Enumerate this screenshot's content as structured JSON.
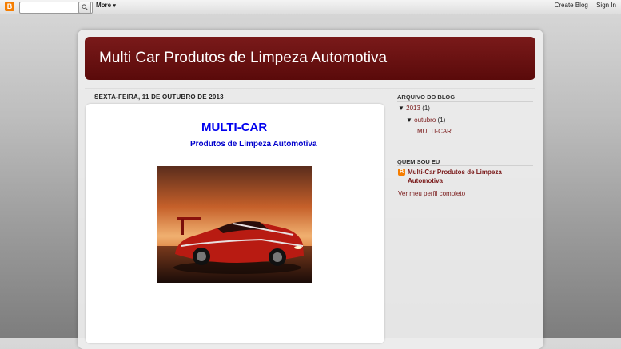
{
  "navbar": {
    "logo": "B",
    "search_value": "",
    "more_label": "More",
    "create_blog": "Create Blog",
    "sign_in": "Sign In"
  },
  "header": {
    "title": "Multi Car Produtos de Limpeza Automotiva"
  },
  "post": {
    "date": "SEXTA-FEIRA, 11 DE OUTUBRO DE 2013",
    "title": "MULTI-CAR",
    "subtitle": "Produtos de Limpeza Automotiva"
  },
  "sidebar": {
    "archive_heading": "ARQUIVO DO BLOG",
    "year": "2013",
    "year_count": "(1)",
    "month": "outubro",
    "month_count": "(1)",
    "post_link": "MULTI-CAR",
    "post_ellipsis": "...",
    "about_heading": "QUEM SOU EU",
    "profile_name_line1": "Multi-Car Produtos de Limpeza",
    "profile_name_line2": "Automotiva",
    "profile_link": "Ver meu perfil completo"
  },
  "icons": {
    "blogger": "blogger-logo-icon",
    "search": "search-icon",
    "expand": "triangle-down-icon"
  },
  "colors": {
    "header_bg": "#6a1212",
    "link": "#7a1a1a",
    "post_title": "#0000ee"
  }
}
